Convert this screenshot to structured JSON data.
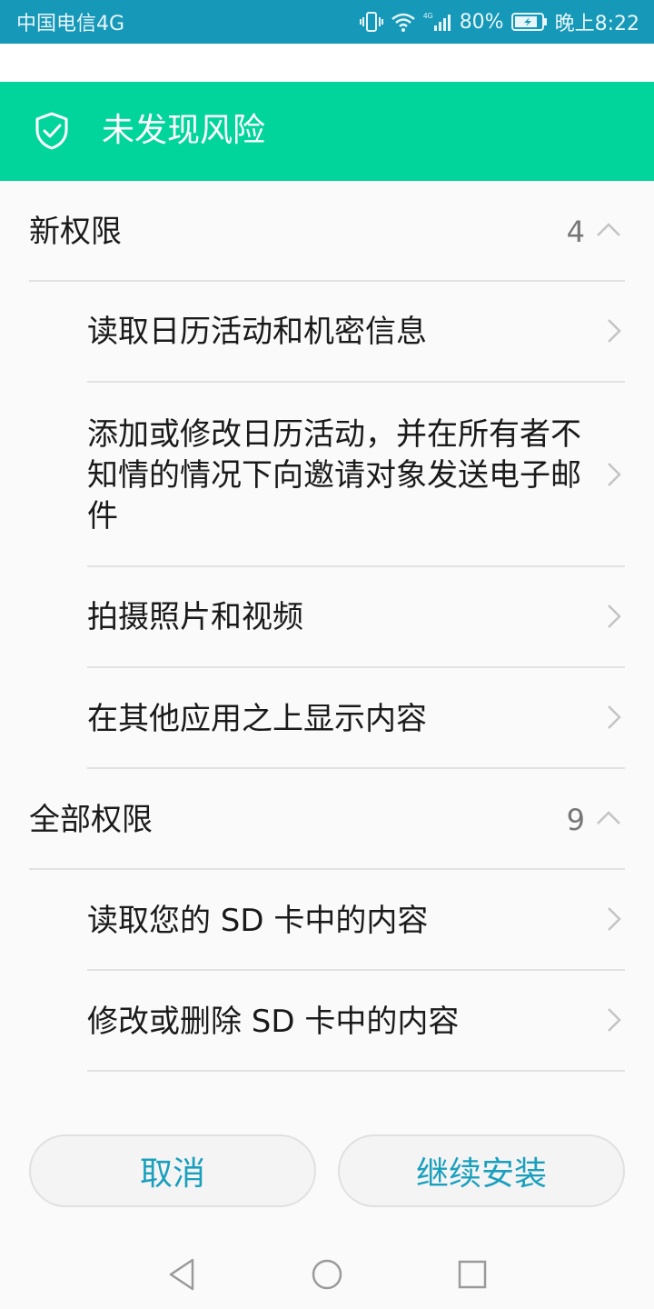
{
  "status_bar": {
    "carrier": "中国电信4G",
    "network": "4G",
    "battery": "80%",
    "time": "晚上8:22",
    "icons": [
      "vibrate-icon",
      "wifi-icon",
      "signal-icon",
      "battery-icon"
    ]
  },
  "banner": {
    "title": "未发现风险",
    "icon": "shield-check-icon",
    "color": "#02d59c"
  },
  "sections": [
    {
      "label": "新权限",
      "count": "4",
      "items": [
        "读取日历活动和机密信息",
        "添加或修改日历活动，并在所有者不知情的情况下向邀请对象发送电子邮件",
        "拍摄照片和视频",
        "在其他应用之上显示内容"
      ]
    },
    {
      "label": "全部权限",
      "count": "9",
      "items": [
        "读取您的 SD 卡中的内容",
        "修改或删除 SD 卡中的内容"
      ]
    }
  ],
  "buttons": {
    "cancel": "取消",
    "continue": "继续安装",
    "accent": "#1a9fbd"
  },
  "navbar": {
    "icons": [
      "back-icon",
      "home-icon",
      "recents-icon"
    ]
  }
}
